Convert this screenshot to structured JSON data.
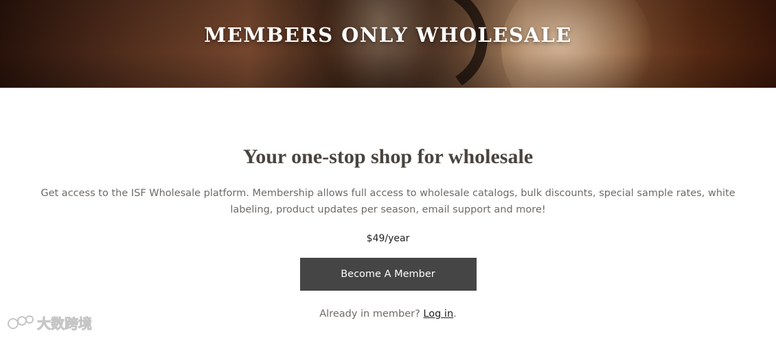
{
  "hero": {
    "title": "MEMBERS ONLY WHOLESALE"
  },
  "main": {
    "heading": "Your one-stop shop for wholesale",
    "description": "Get access to the ISF Wholesale platform. Membership allows full access to wholesale catalogs, bulk discounts, special sample rates, white labeling, product updates per season, email support and more!",
    "price": "$49/year",
    "cta_label": "Become A Member",
    "login_prompt": "Already in member? ",
    "login_link": "Log in",
    "login_suffix": "."
  },
  "watermark": {
    "text": "大数跨境",
    "icon": "logo-mark"
  }
}
